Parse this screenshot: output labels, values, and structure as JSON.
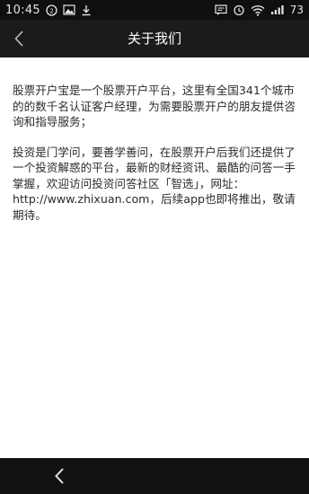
{
  "status_bar": {
    "time": "10:45",
    "battery": "73",
    "left_icons": [
      "circle-2-icon",
      "photo-icon",
      "download-icon"
    ],
    "right_icons": [
      "message-icon",
      "alarm-icon",
      "wifi-icon",
      "signal-icon"
    ]
  },
  "header": {
    "title": "关于我们",
    "back_icon": "chevron-left-icon"
  },
  "content": {
    "paragraphs": [
      "股票开户宝是一个股票开户平台，这里有全国341个城市的的数千名认证客户经理，为需要股票开户的朋友提供咨询和指导服务；",
      "投资是门学问，要善学善问，在股票开户后我们还提供了一个投资解惑的平台，最新的财经资讯、最酷的问答一手掌握，欢迎访问投资问答社区「智选」，网址：http://www.zhixuan.com，后续app也即将推出，敬请期待。"
    ]
  },
  "nav_bar": {
    "back_icon": "back-arrow-icon"
  },
  "colors": {
    "status_bar_bg": "#0f0f0f",
    "title_bar_bg": "#1b1b1b",
    "body_bg": "#ffffff",
    "text": "#2b2b2b"
  }
}
